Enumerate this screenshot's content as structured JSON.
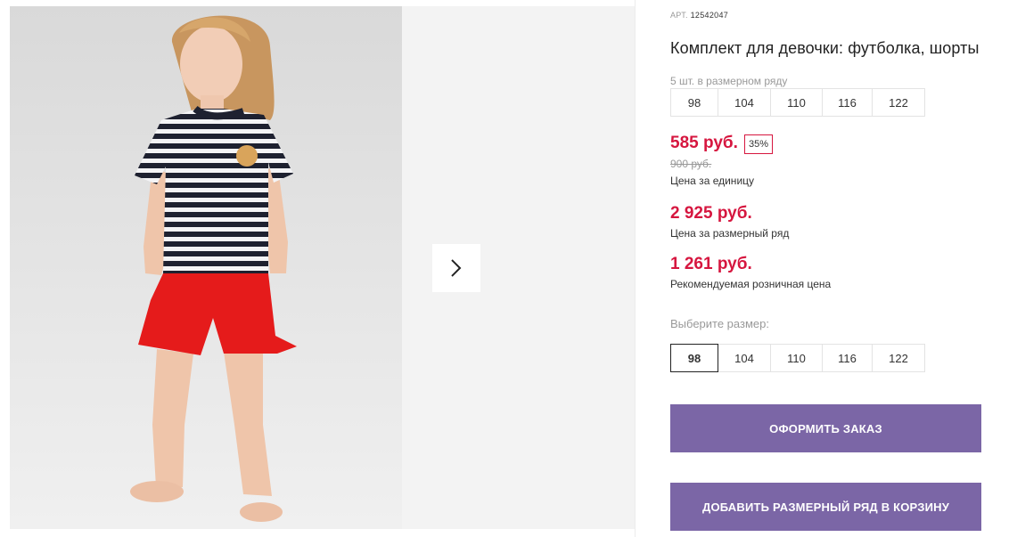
{
  "gallery": {
    "next_button_icon": "chevron-right-icon"
  },
  "product": {
    "sku_label": "АРТ.",
    "sku": "12542047",
    "title": "Комплект для девочки: футболка, шорты",
    "pack_note": "5 шт. в размерном ряду",
    "pack_sizes": [
      "98",
      "104",
      "110",
      "116",
      "122"
    ],
    "price": "585 руб.",
    "discount": "35%",
    "old_price": "900 руб.",
    "price_caption": "Цена за единицу",
    "pack_price": "2 925 руб.",
    "pack_price_caption": "Цена за размерный ряд",
    "retail_price": "1 261 руб.",
    "retail_caption": "Рекомендуемая розничная цена",
    "choose_size_label": "Выберите размер:",
    "sizes": [
      "98",
      "104",
      "110",
      "116",
      "122"
    ],
    "selected_size": "98"
  },
  "actions": {
    "order_label": "ОФОРМИТЬ ЗАКАЗ",
    "add_pack_label": "ДОБАВИТЬ РАЗМЕРНЫЙ РЯД В КОРЗИНУ"
  },
  "colors": {
    "accent": "#7b66a6",
    "price": "#d6163f"
  }
}
